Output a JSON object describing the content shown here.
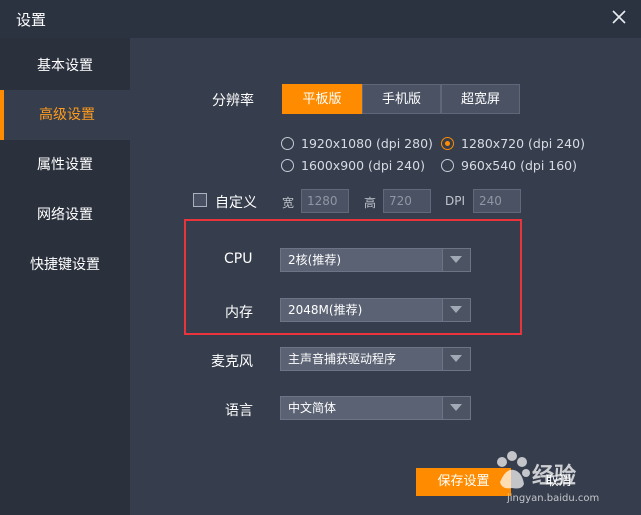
{
  "window": {
    "title": "设置"
  },
  "sidebar": {
    "items": [
      {
        "label": "基本设置",
        "active": false
      },
      {
        "label": "高级设置",
        "active": true
      },
      {
        "label": "属性设置",
        "active": false
      },
      {
        "label": "网络设置",
        "active": false
      },
      {
        "label": "快捷键设置",
        "active": false
      }
    ]
  },
  "resolution": {
    "label": "分辨率",
    "tabs": [
      {
        "label": "平板版",
        "selected": true
      },
      {
        "label": "手机版",
        "selected": false
      },
      {
        "label": "超宽屏",
        "selected": false
      }
    ],
    "options": [
      {
        "label": "1920x1080 (dpi 280)",
        "checked": false
      },
      {
        "label": "1280x720 (dpi 240)",
        "checked": true
      },
      {
        "label": "1600x900 (dpi 240)",
        "checked": false
      },
      {
        "label": "960x540 (dpi 160)",
        "checked": false
      }
    ],
    "custom": {
      "label": "自定义",
      "width_label": "宽",
      "width_value": "1280",
      "height_label": "高",
      "height_value": "720",
      "dpi_label": "DPI",
      "dpi_value": "240"
    }
  },
  "cpu": {
    "label": "CPU",
    "value": "2核(推荐)"
  },
  "memory": {
    "label": "内存",
    "value": "2048M(推荐)"
  },
  "microphone": {
    "label": "麦克风",
    "value": "主声音捕获驱动程序"
  },
  "language": {
    "label": "语言",
    "value": "中文简体"
  },
  "buttons": {
    "save": "保存设置",
    "cancel": "取消"
  },
  "watermark": {
    "brand": "经验",
    "url": "jingyan.baidu.com"
  },
  "colors": {
    "accent": "#ff8c00",
    "highlight_box": "#e8343a",
    "background": "#363d4c",
    "sidebar": "#2a303c"
  }
}
